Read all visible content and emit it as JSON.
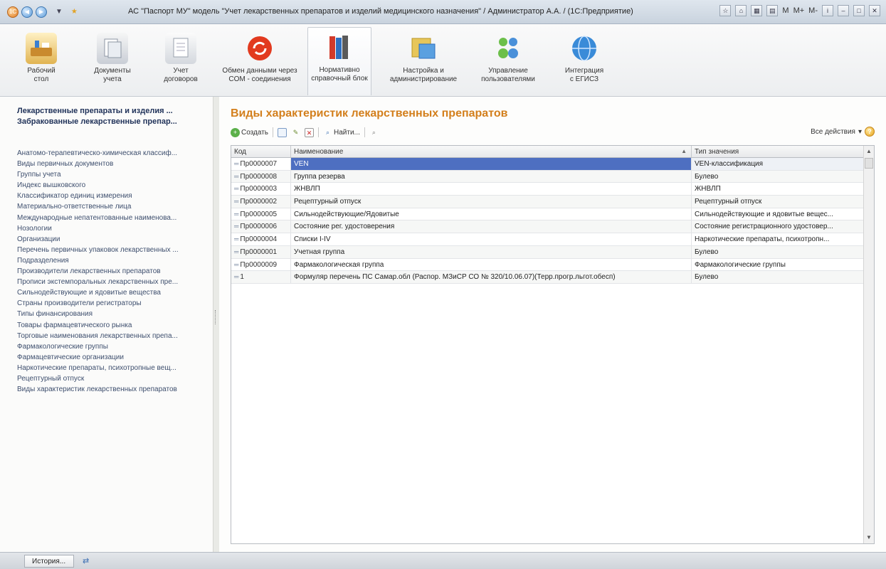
{
  "window": {
    "title": "АС \"Паспорт МУ\" модель \"Учет лекарственных препаратов и изделий медицинского назначения\" / Администратор А.А. / (1С:Предприятие)",
    "mini_buttons": [
      "M",
      "M+",
      "M-"
    ]
  },
  "ribbon": {
    "items": [
      {
        "label1": "Рабочий",
        "label2": "стол",
        "icon": "desktop-icon"
      },
      {
        "label1": "Документы",
        "label2": "учета",
        "icon": "documents-icon"
      },
      {
        "label1": "Учет",
        "label2": "договоров",
        "icon": "contracts-icon"
      },
      {
        "label1": "Обмен данными через",
        "label2": "COM - соединения",
        "icon": "exchange-icon"
      },
      {
        "label1": "Нормативно",
        "label2": "справочный блок",
        "icon": "books-icon"
      },
      {
        "label1": "Настройка и",
        "label2": "администрирование",
        "icon": "settings-icon"
      },
      {
        "label1": "Управление",
        "label2": "пользователями",
        "icon": "users-icon"
      },
      {
        "label1": "Интеграция",
        "label2": "с ЕГИСЗ",
        "icon": "globe-icon"
      }
    ]
  },
  "leftpanel": {
    "head1": "Лекарственные препараты и изделия ...",
    "head2": "Забракованные лекарственные препар...",
    "items": [
      "Анатомо-терапевтическо-химическая классиф...",
      "Виды первичных документов",
      "Группы учета",
      "Индекс вышковского",
      "Классификатор единиц измерения",
      "Материально-ответственные лица",
      "Международные непатентованные наименова...",
      "Нозологии",
      "Организации",
      "Перечень первичных упаковок лекарственных ...",
      "Подразделения",
      "Производители лекарственных препаратов",
      "Прописи экстемпоральных лекарственных пре...",
      "Сильнодействующие и ядовитые вещества",
      "Страны производители регистраторы",
      "Типы финансирования",
      "Товары фармацевтического рынка",
      "Торговые наименования лекарственных препа...",
      "Фармакологические группы",
      "Фармацевтические организации",
      "Наркотические препараты, психотропные вещ...",
      "Рецептурный отпуск",
      "Виды характеристик лекарственных препаратов"
    ]
  },
  "content": {
    "title": "Виды характеристик лекарственных препаратов",
    "toolbar": {
      "create": "Создать",
      "find": "Найти...",
      "all_actions": "Все действия"
    },
    "table": {
      "headers": {
        "code": "Код",
        "name": "Наименование",
        "type": "Тип значения"
      },
      "rows": [
        {
          "code": "Пр0000007",
          "name": "VEN",
          "type": "VEN-классификация"
        },
        {
          "code": "Пр0000008",
          "name": "Группа резерва",
          "type": "Булево"
        },
        {
          "code": "Пр0000003",
          "name": "ЖНВЛП",
          "type": "ЖНВЛП"
        },
        {
          "code": "Пр0000002",
          "name": "Рецептурный отпуск",
          "type": "Рецептурный отпуск"
        },
        {
          "code": "Пр0000005",
          "name": "Сильнодействующие/Ядовитые",
          "type": "Сильнодействующие и ядовитые вещес..."
        },
        {
          "code": "Пр0000006",
          "name": "Состояние рег. удостоверения",
          "type": "Состояние регистрационного удостовер..."
        },
        {
          "code": "Пр0000004",
          "name": "Списки I-IV",
          "type": "Наркотические препараты, психотропн..."
        },
        {
          "code": "Пр0000001",
          "name": "Учетная группа",
          "type": "Булево"
        },
        {
          "code": "Пр0000009",
          "name": "Фармакологическая группа",
          "type": "Фармакологические группы"
        },
        {
          "code": "1",
          "name": "Формуляр перечень ПС Самар.обл (Распор. МЗиСР СО № 320/10.06.07)(Терр.прогр.льгот.обесп)",
          "type": "Булево"
        }
      ]
    }
  },
  "statusbar": {
    "history": "История..."
  }
}
